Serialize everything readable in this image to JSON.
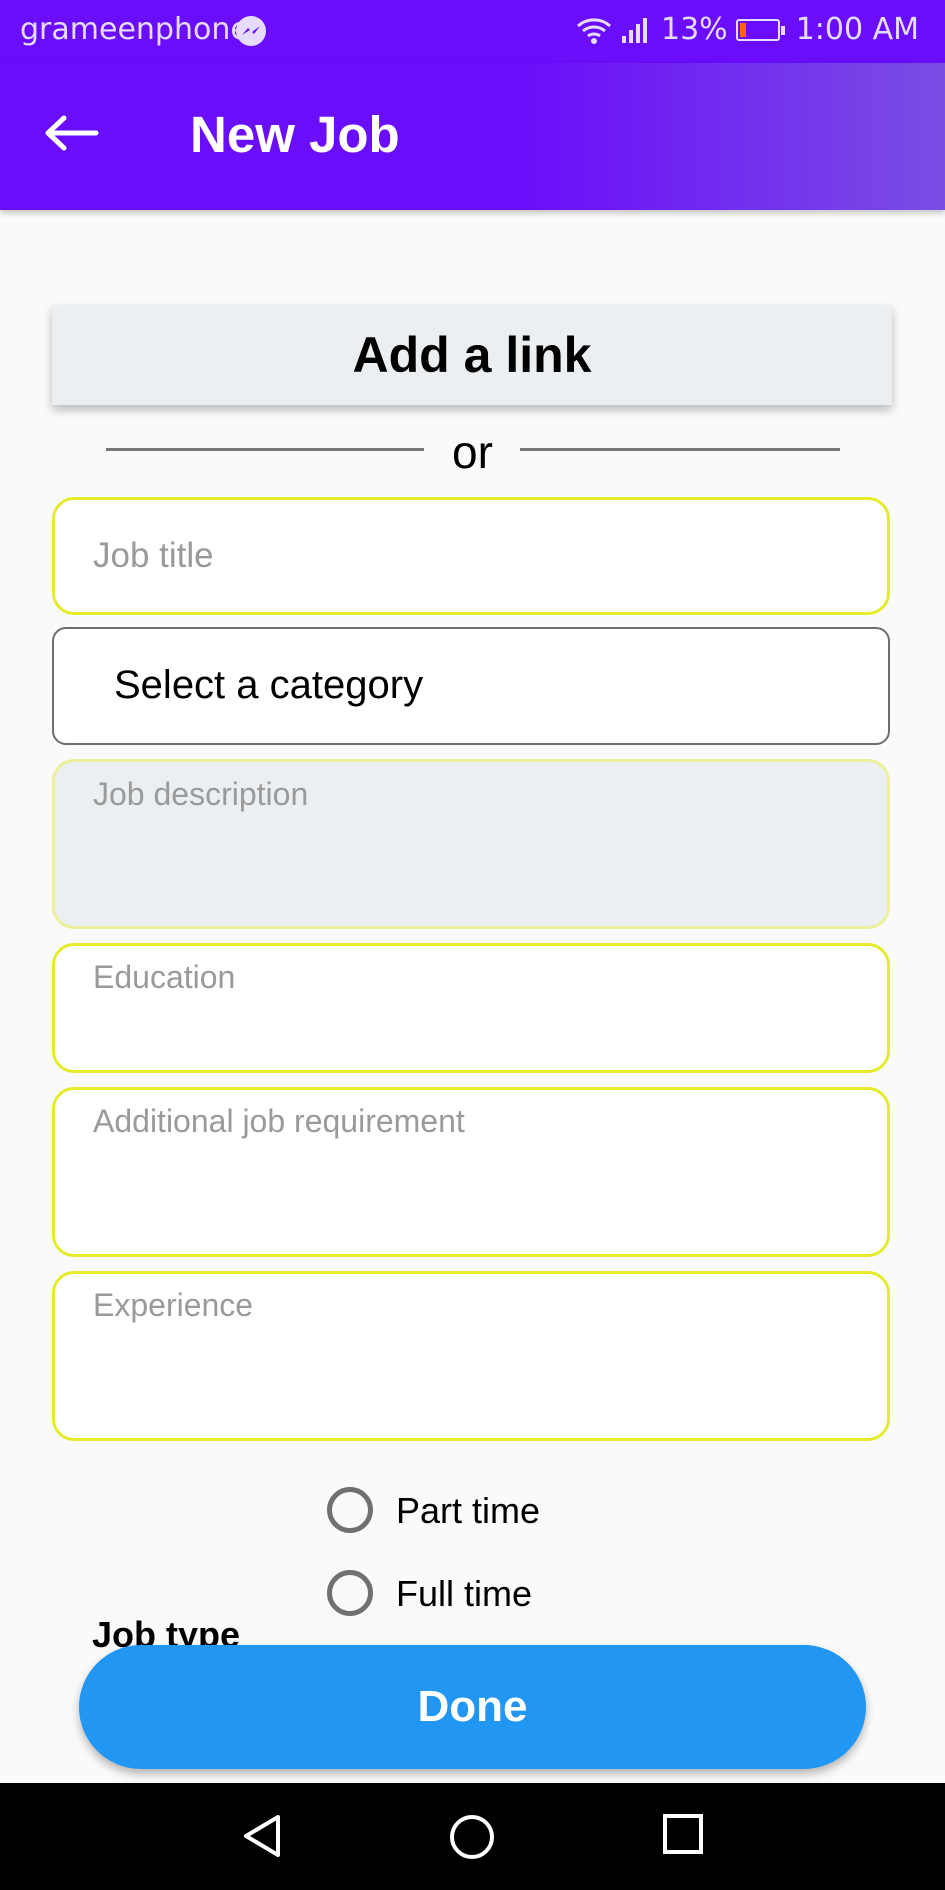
{
  "status_bar": {
    "carrier": "grameenphone",
    "battery_percent": "13%",
    "time": "1:00 AM",
    "icons": [
      "messenger-icon",
      "wifi-icon",
      "signal-icon",
      "battery-icon"
    ],
    "battery_level": 0.13,
    "battery_color": "#ff6a00"
  },
  "app_bar": {
    "title": "New Job",
    "back_icon": "arrow-left-icon",
    "color": "#6a0dfb"
  },
  "link_card": {
    "label": "Add a link"
  },
  "divider": {
    "text": "or"
  },
  "form": {
    "job_title_placeholder": "Job title",
    "category_value": "Select a category",
    "job_description_placeholder": "Job description",
    "education_placeholder": "Education",
    "additional_requirement_placeholder": "Additional job requirement",
    "experience_placeholder": "Experience",
    "field_border_color": "#e5ec2a"
  },
  "job_type": {
    "label": "Job type",
    "options": [
      "Part time",
      "Full time"
    ],
    "selected": null
  },
  "done_button": {
    "label": "Done",
    "color": "#2196f3"
  },
  "nav_bar": {
    "icons": [
      "back-triangle-icon",
      "home-circle-icon",
      "recents-square-icon"
    ]
  }
}
